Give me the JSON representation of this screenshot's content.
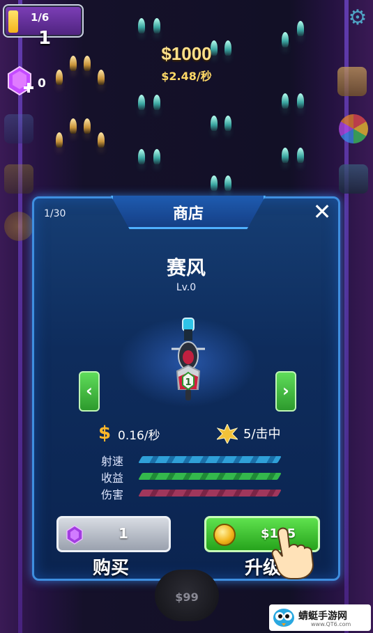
{
  "hud": {
    "stage_progress": "1/6",
    "level": "1",
    "money": "$1000",
    "rate": "$2.48/秒",
    "gems": "0"
  },
  "bottom": {
    "price": "$99"
  },
  "shop": {
    "title": "商店",
    "page": "1/30",
    "close": "✕",
    "item_name": "赛风",
    "item_level": "Lv.0",
    "badge": "1",
    "stats": {
      "income_per_sec": "0.16/秒",
      "per_hit": "5/击中"
    },
    "bars": [
      {
        "label": "射速",
        "color": "#2fa0d8"
      },
      {
        "label": "收益",
        "color": "#34b84c"
      },
      {
        "label": "伤害",
        "color": "#a0375c"
      }
    ],
    "buy": {
      "count": "1",
      "caption": "购买"
    },
    "upgrade": {
      "price": "$105",
      "caption": "升级"
    }
  },
  "watermark": {
    "name": "蜻蜓手游网",
    "url": "www.QT6.com"
  }
}
